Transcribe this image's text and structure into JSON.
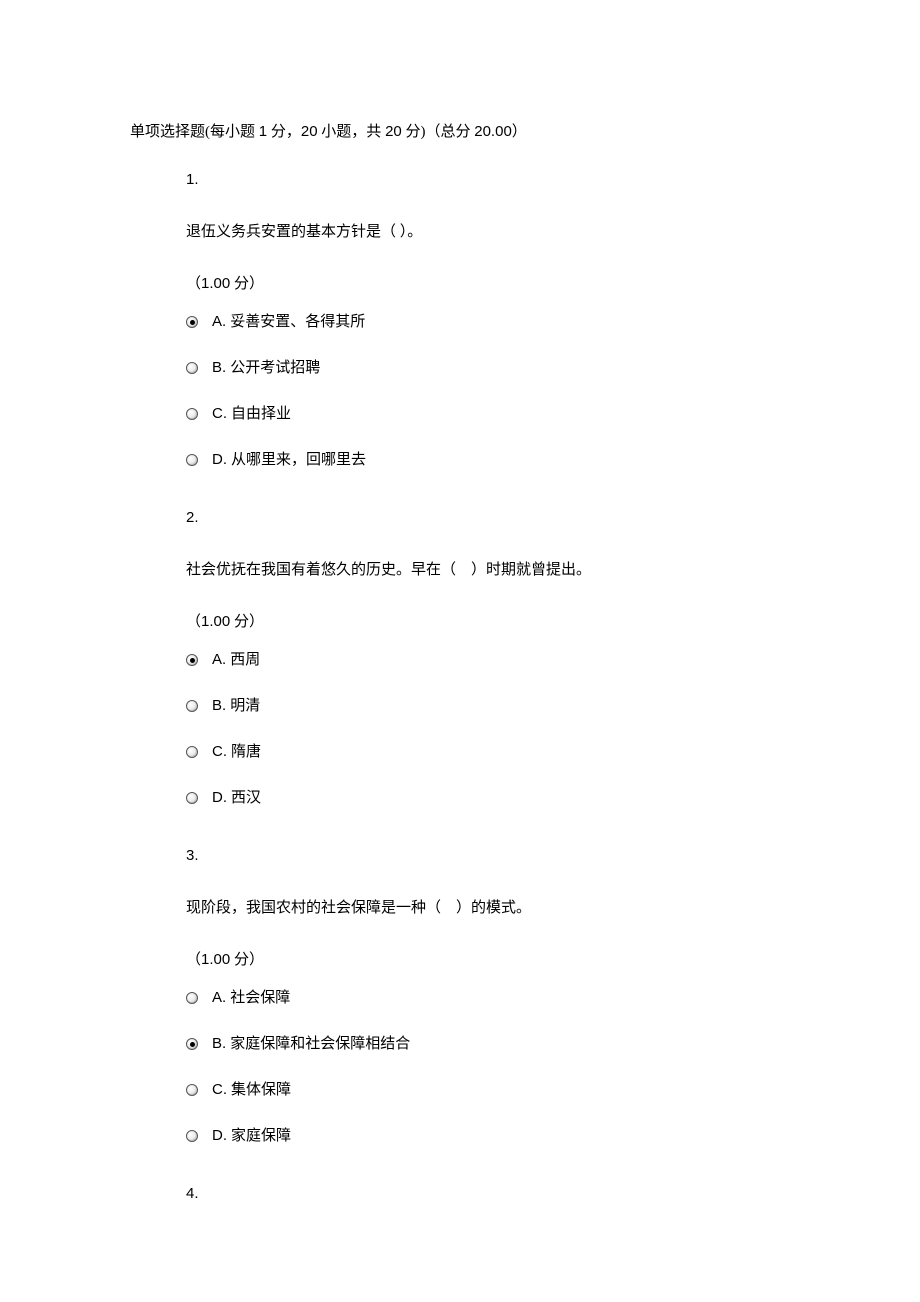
{
  "section": {
    "title_prefix": "单项选择题(每小题 ",
    "per_points": "1",
    "mid1": " 分，",
    "count": "20",
    "mid2": " 小题，共 ",
    "total": "20",
    "mid3": " 分)（总分 ",
    "grand_total": "20.00",
    "suffix": "）"
  },
  "points_label_prefix": "（",
  "points_value": "1.00",
  "points_label_suffix": " 分）",
  "questions": [
    {
      "number": "1.",
      "text": "退伍义务兵安置的基本方针是（ ）。",
      "selected": 0,
      "options": [
        {
          "letter": "A.",
          "text": "妥善安置、各得其所"
        },
        {
          "letter": "B.",
          "text": "公开考试招聘"
        },
        {
          "letter": "C.",
          "text": "自由择业"
        },
        {
          "letter": "D.",
          "text": "从哪里来，回哪里去"
        }
      ]
    },
    {
      "number": "2.",
      "text": "社会优抚在我国有着悠久的历史。早在（　）时期就曾提出。",
      "selected": 0,
      "options": [
        {
          "letter": "A.",
          "text": "西周"
        },
        {
          "letter": "B.",
          "text": "明清"
        },
        {
          "letter": "C.",
          "text": "隋唐"
        },
        {
          "letter": "D.",
          "text": "西汉"
        }
      ]
    },
    {
      "number": "3.",
      "text": "现阶段，我国农村的社会保障是一种（　）的模式。",
      "selected": 1,
      "options": [
        {
          "letter": "A.",
          "text": "社会保障"
        },
        {
          "letter": "B.",
          "text": "家庭保障和社会保障相结合"
        },
        {
          "letter": "C.",
          "text": "集体保障"
        },
        {
          "letter": "D.",
          "text": "家庭保障"
        }
      ]
    },
    {
      "number": "4.",
      "text": "",
      "selected": -1,
      "options": []
    }
  ]
}
